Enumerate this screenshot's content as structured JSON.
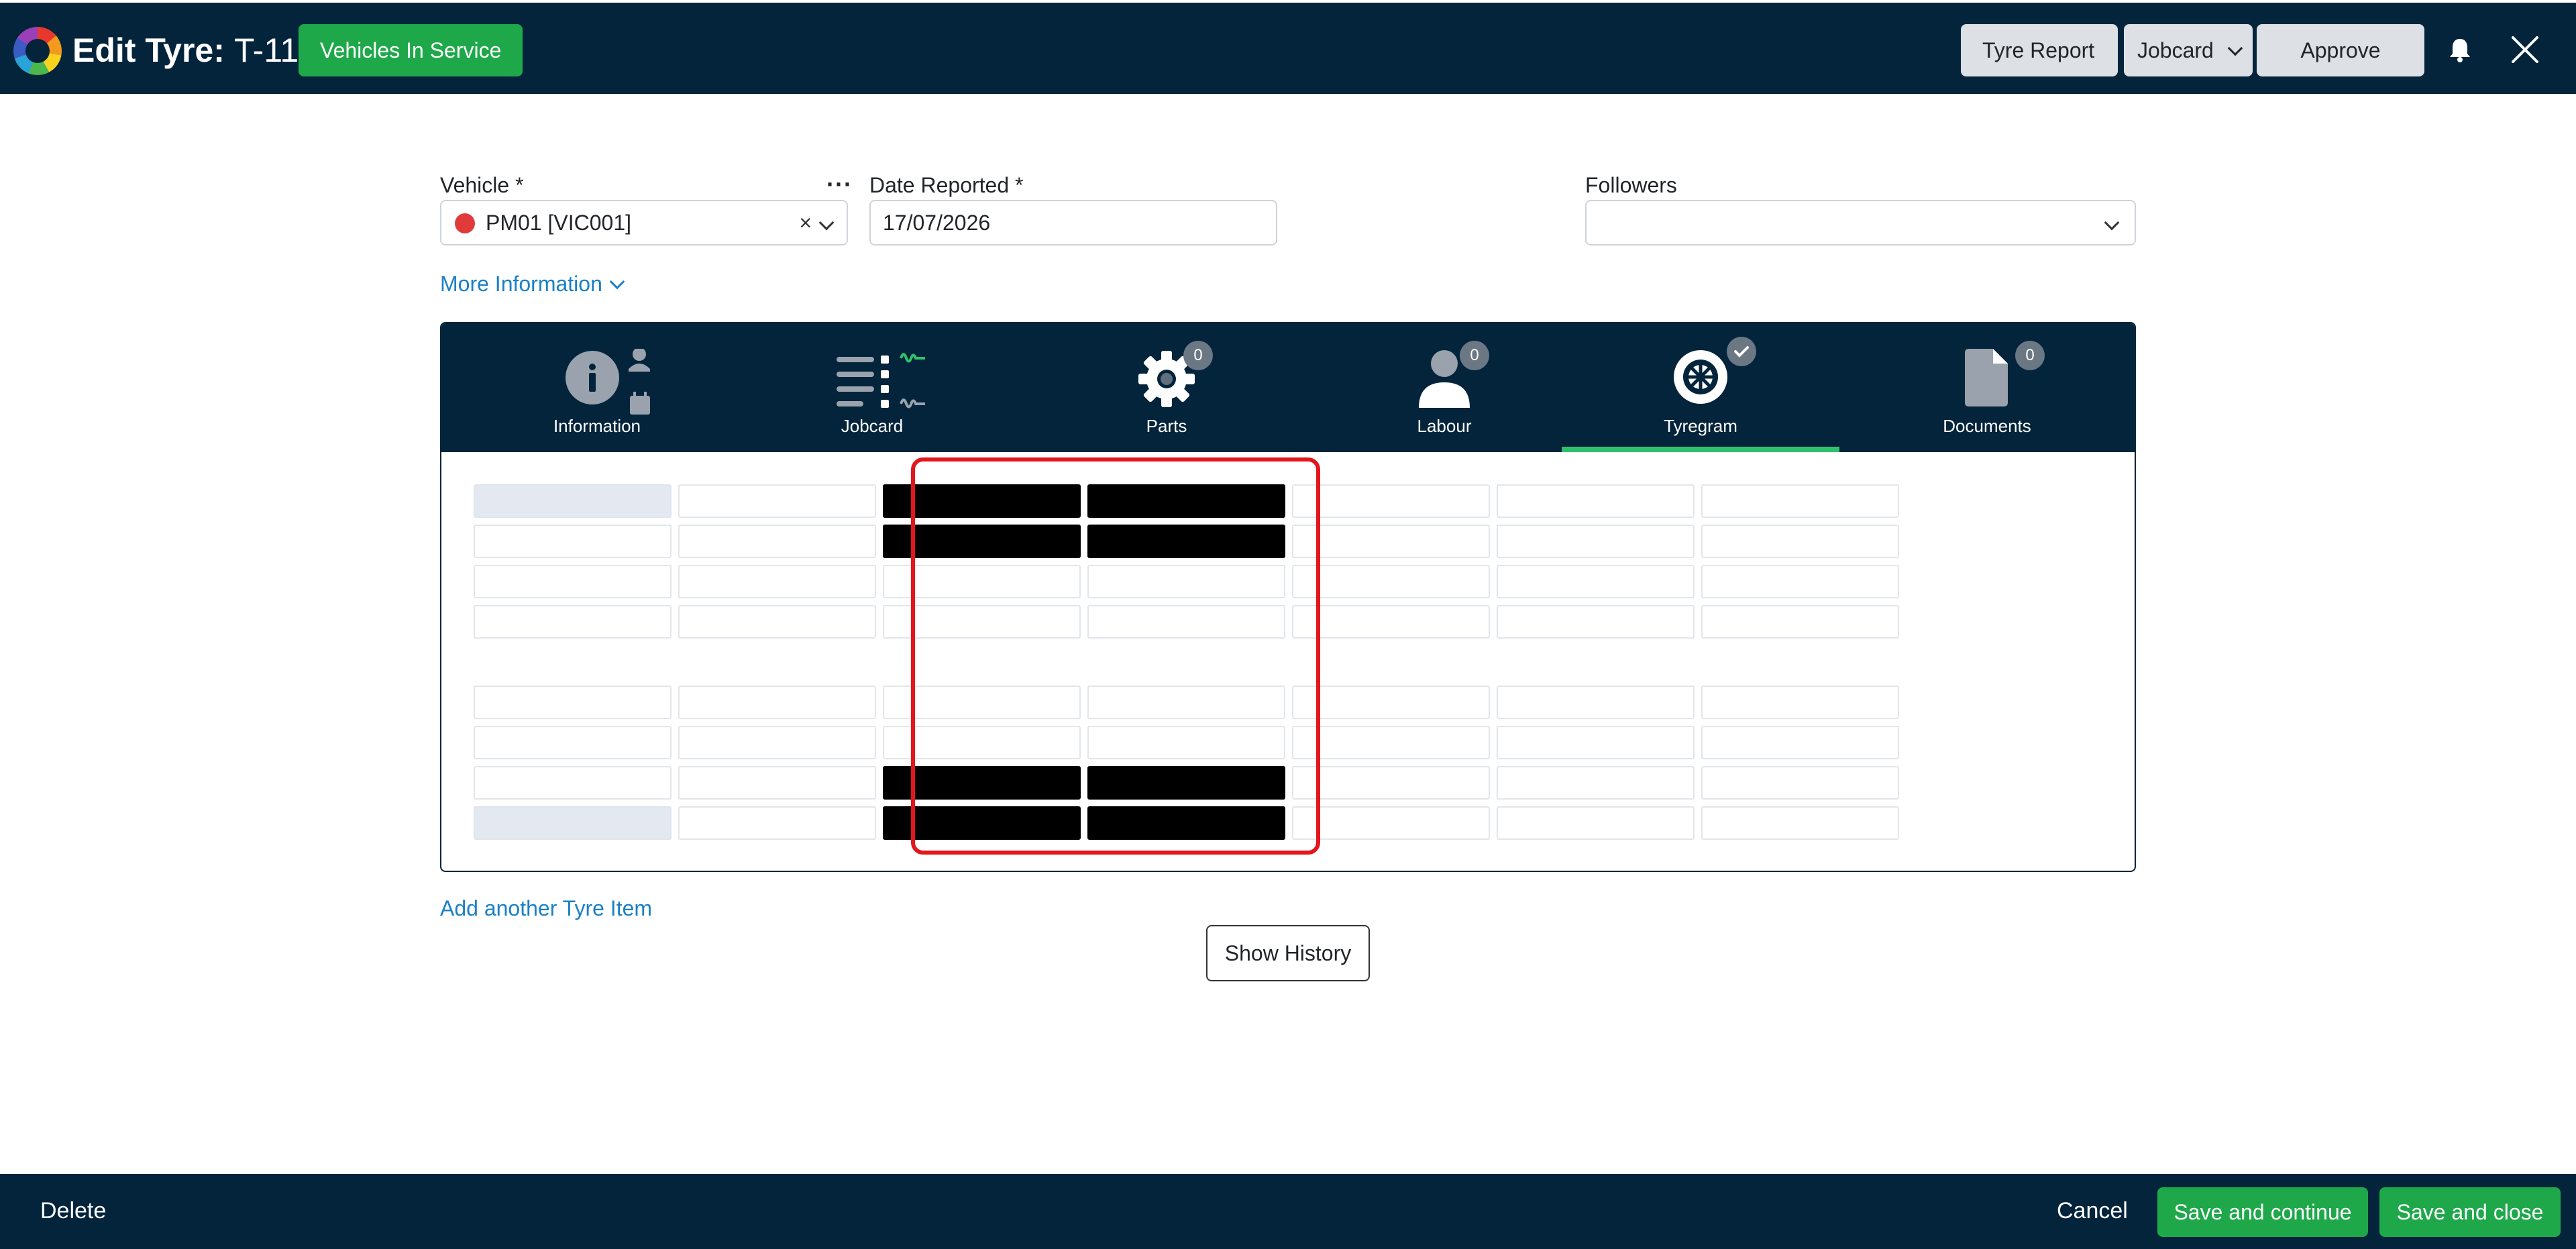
{
  "header": {
    "title_bold": "Edit Tyre:",
    "title_id": "T-11",
    "status": "Vehicles In Service",
    "tyre_report_label": "Tyre Report",
    "jobcard_label": "Jobcard",
    "approve_label": "Approve"
  },
  "form": {
    "vehicle_label": "Vehicle *",
    "vehicle_value": "PM01 [VIC001]",
    "vehicle_clear": "×",
    "date_label": "Date Reported *",
    "date_value": "17/07/2026",
    "followers_label": "Followers",
    "followers_value": "",
    "more_info": "More Information"
  },
  "tabs": [
    {
      "label": "Information",
      "icon": "info-icon"
    },
    {
      "label": "Jobcard",
      "icon": "list-icon"
    },
    {
      "label": "Parts",
      "icon": "gear-icon",
      "badge": "0"
    },
    {
      "label": "Labour",
      "icon": "person-icon",
      "badge": "0"
    },
    {
      "label": "Tyregram",
      "icon": "tyre-icon",
      "active": true
    },
    {
      "label": "Documents",
      "icon": "document-icon",
      "badge": "0"
    }
  ],
  "actions": {
    "add_item": "Add another Tyre Item",
    "show_history": "Show History"
  },
  "footer": {
    "delete_label": "Delete",
    "cancel_label": "Cancel",
    "save_continue_label": "Save and continue",
    "save_close_label": "Save and close"
  },
  "colors": {
    "navy": "#03243b",
    "green": "#1ea84a",
    "link": "#1a80c6",
    "highlight": "#e3161b"
  }
}
